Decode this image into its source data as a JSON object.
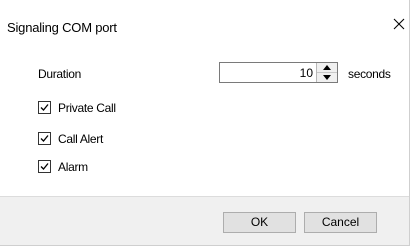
{
  "dialog": {
    "title": "Signaling COM port",
    "close_icon": "close-icon"
  },
  "duration": {
    "label": "Duration",
    "value": "10",
    "unit": "seconds",
    "up_icon": "spin-up-icon",
    "down_icon": "spin-down-icon"
  },
  "options": [
    {
      "label": "Private Call",
      "checked": true
    },
    {
      "label": "Call Alert",
      "checked": true
    },
    {
      "label": "Alarm",
      "checked": true
    }
  ],
  "buttons": {
    "ok_label": "OK",
    "cancel_label": "Cancel"
  },
  "colors": {
    "footer_bg": "#f0f0f0",
    "button_bg": "#e1e1e1",
    "button_border": "#adadad",
    "input_border": "#7a7a7a"
  }
}
